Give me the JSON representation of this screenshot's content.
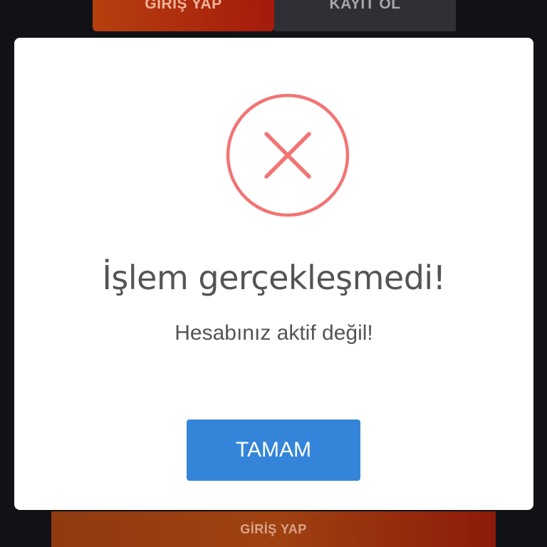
{
  "background": {
    "tabs": [
      {
        "label": "GİRİŞ YAP",
        "active": true
      },
      {
        "label": "KAYIT OL",
        "active": false
      }
    ],
    "bottom_button_label": "GİRİŞ YAP"
  },
  "dialog": {
    "icon": "error-x-icon",
    "icon_color": "#f27474",
    "title": "İşlem gerçekleşmedi!",
    "message": "Hesabınız aktif değil!",
    "confirm_label": "TAMAM",
    "confirm_color": "#3485d9"
  }
}
